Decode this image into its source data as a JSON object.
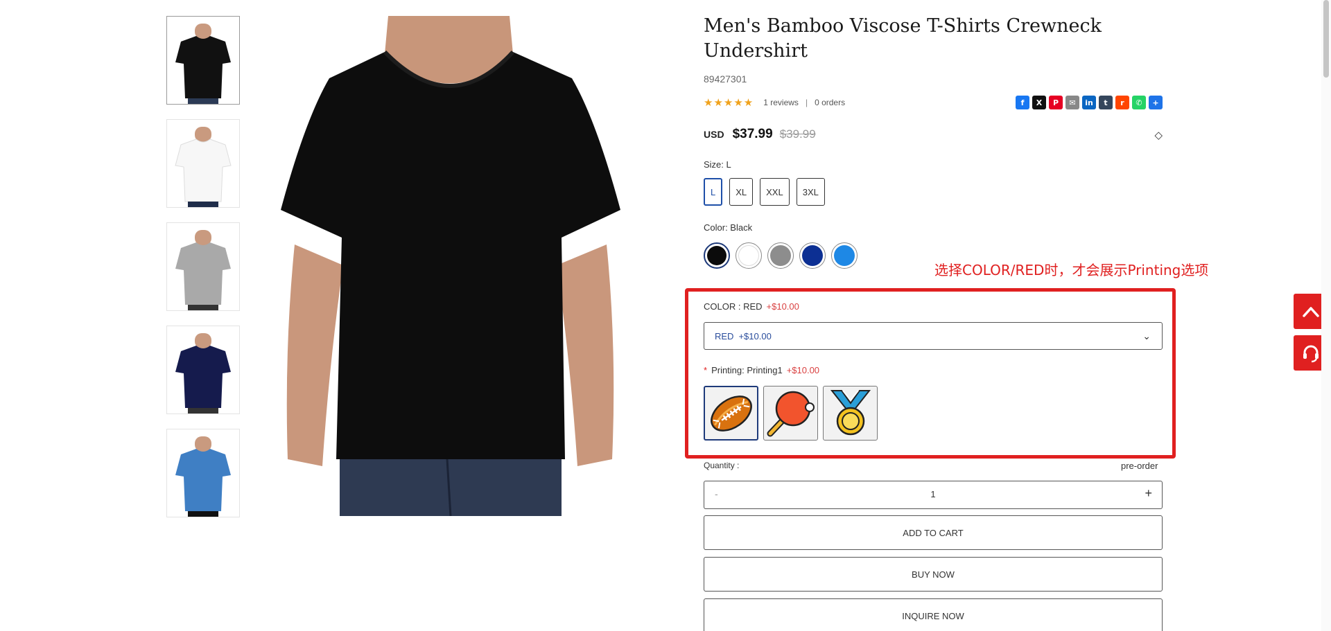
{
  "product": {
    "title": "Men's Bamboo Viscose T-Shirts Crewneck Undershirt",
    "sku": "89427301",
    "rating_stars": "★★★★★",
    "reviews": "1 reviews",
    "orders": "0 orders",
    "separator": "|",
    "currency": "USD",
    "price": "$37.99",
    "original_price": "$39.99"
  },
  "share_icons": [
    {
      "name": "facebook-icon",
      "glyph": "f",
      "color": "#1877f2"
    },
    {
      "name": "x-icon",
      "glyph": "X",
      "color": "#111111"
    },
    {
      "name": "pinterest-icon",
      "glyph": "P",
      "color": "#e60023"
    },
    {
      "name": "email-icon",
      "glyph": "✉",
      "color": "#888888"
    },
    {
      "name": "linkedin-icon",
      "glyph": "in",
      "color": "#0a66c2"
    },
    {
      "name": "tumblr-icon",
      "glyph": "t",
      "color": "#35465c"
    },
    {
      "name": "reddit-icon",
      "glyph": "r",
      "color": "#ff4500"
    },
    {
      "name": "whatsapp-icon",
      "glyph": "✆",
      "color": "#25d366"
    },
    {
      "name": "share-more-icon",
      "glyph": "+",
      "color": "#1e73e8"
    }
  ],
  "size": {
    "label": "Size: L",
    "options": [
      "L",
      "XL",
      "XXL",
      "3XL"
    ],
    "selected": "L"
  },
  "color": {
    "label": "Color: Black",
    "swatches": [
      "#0b0b0b",
      "#ffffff",
      "#8d8d8d",
      "#0c2f93",
      "#1e88e5"
    ],
    "selected_index": 0
  },
  "annotation": "选择COLOR/RED时，才会展示Printing选项",
  "option_color": {
    "label": "COLOR : RED",
    "addon": "+$10.00",
    "select_value": "RED",
    "select_addon": "+$10.00"
  },
  "printing": {
    "required_mark": "*",
    "label": "Printing: Printing1",
    "addon": "+$10.00",
    "options": [
      "football-print-icon",
      "ping-pong-paddle-print-icon",
      "medal-print-icon"
    ],
    "selected_index": 0
  },
  "quantity": {
    "label": "Quantity :",
    "stock_status": "pre-order",
    "minus": "-",
    "value": "1",
    "plus": "+"
  },
  "buttons": {
    "add_to_cart": "ADD TO CART",
    "buy_now": "BUY NOW",
    "inquire_now": "INQUIRE NOW"
  },
  "thumbnails": [
    "#111111",
    "#ffffff",
    "#a9a9a9",
    "#151b4d",
    "#3f7fc4"
  ],
  "accent_color": "#e02020"
}
